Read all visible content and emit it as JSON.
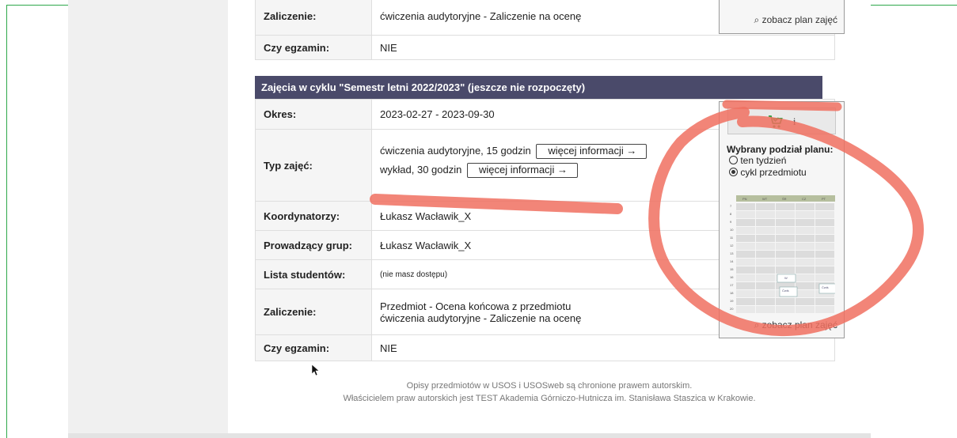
{
  "top_table": {
    "rows": [
      {
        "label": "Zaliczenie:",
        "value": "ćwiczenia audytoryjne - Zaliczenie na ocenę"
      },
      {
        "label": "Czy egzamin:",
        "value": "NIE"
      }
    ],
    "plan_link": "zobacz plan zajęć"
  },
  "cycle": {
    "header": "Zajęcia w cyklu \"Semestr letni 2022/2023\" (jeszcze nie rozpoczęty)",
    "rows": {
      "okres": {
        "label": "Okres:",
        "value": "2023-02-27 - 2023-09-30"
      },
      "typ": {
        "label": "Typ zajęć:",
        "line1": "ćwiczenia audytoryjne, 15 godzin",
        "line2": "wykład, 30 godzin",
        "more_button": "więcej informacji →"
      },
      "koordynatorzy": {
        "label": "Koordynatorzy:",
        "value": "Łukasz Wacławik_X"
      },
      "prowadzacy": {
        "label": "Prowadzący grup:",
        "value": "Łukasz Wacławik_X"
      },
      "lista": {
        "label": "Lista studentów:",
        "value": "(nie masz dostępu)"
      },
      "zaliczenie": {
        "label": "Zaliczenie:",
        "line1": "Przedmiot - Ocena końcowa z przedmiotu",
        "line2": "ćwiczenia audytoryjne - Zaliczenie na ocenę"
      },
      "egzamin": {
        "label": "Czy egzamin:",
        "value": "NIE"
      }
    },
    "side": {
      "cart_info": "i",
      "plan_title": "Wybrany podział planu:",
      "options": [
        {
          "label": "ten tydzień",
          "selected": false
        },
        {
          "label": "cykl przedmiotu",
          "selected": true
        }
      ],
      "days": [
        "PN",
        "WT",
        "ŚR",
        "CZ",
        "PT"
      ],
      "hours": [
        "7",
        "8",
        "9",
        "10",
        "11",
        "12",
        "13",
        "14",
        "15",
        "16",
        "17",
        "18",
        "19",
        "20"
      ],
      "events": [
        "W",
        "Ćwiś",
        "Ćwiś"
      ],
      "plan_link": "zobacz plan zajęć"
    }
  },
  "footer": {
    "line1": "Opisy przedmiotów w USOS i USOSweb są chronione prawem autorskim.",
    "line2": "Właścicielem praw autorskich jest TEST Akademia Górniczo-Hutnicza im. Stanisława Staszica w Krakowie."
  },
  "colors": {
    "header_bg": "#4a4a6a",
    "annotation": "#f07060",
    "frame": "#2ea84a",
    "cart": "#2a9a3a"
  }
}
